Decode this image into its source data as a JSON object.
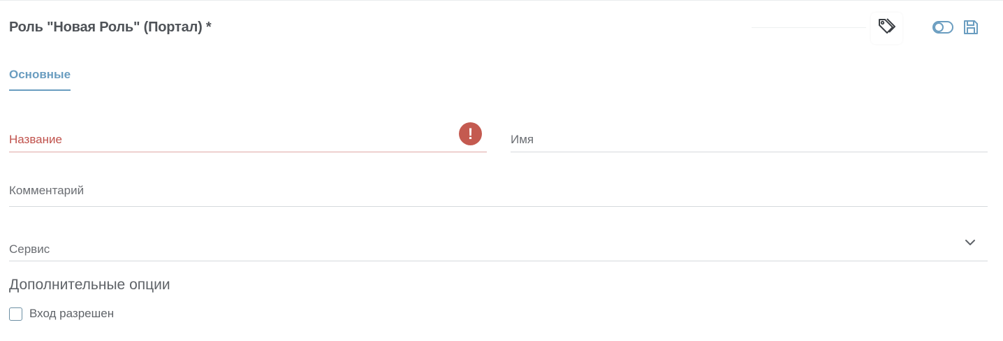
{
  "header": {
    "title": "Роль \"Новая Роль\" (Портал) *",
    "tag_icon": "tag-icon",
    "toggle_icon": "toggle-icon",
    "save_icon": "save-icon"
  },
  "tabs": [
    {
      "label": "Основные",
      "active": true
    }
  ],
  "form": {
    "name_field": {
      "label": "Название",
      "value": "",
      "error": true,
      "error_icon": "exclamation-icon"
    },
    "fullname_field": {
      "label": "Имя",
      "value": ""
    },
    "comment_field": {
      "label": "Комментарий",
      "value": ""
    },
    "service_field": {
      "label": "Сервис",
      "value": "",
      "dropdown_icon": "chevron-down-icon"
    }
  },
  "extra_options": {
    "title": "Дополнительные опции",
    "login_allowed": {
      "label": "Вход разрешен",
      "checked": false
    }
  },
  "colors": {
    "accent": "#6a9dc0",
    "error": "#c45a50",
    "text": "#4f5358"
  }
}
